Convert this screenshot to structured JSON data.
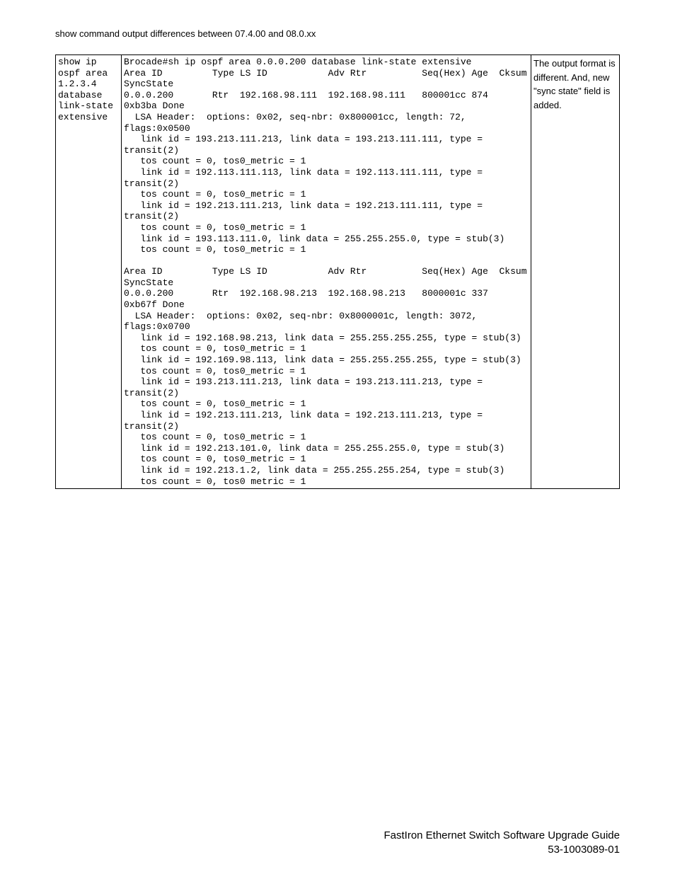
{
  "header": {
    "title": "show command output differences between 07.4.00 and 08.0.xx"
  },
  "table": {
    "command": "show ip ospf area 1.2.3.4 database link-state extensive",
    "output": "Brocade#sh ip ospf area 0.0.0.200 database link-state extensive\nArea ID         Type LS ID           Adv Rtr          Seq(Hex) Age  Cksum  \nSyncState\n0.0.0.200       Rtr  192.168.98.111  192.168.98.111   800001cc 874   \n0xb3ba Done\n  LSA Header:  options: 0x02, seq-nbr: 0x800001cc, length: 72, \nflags:0x0500\n   link id = 193.213.111.213, link data = 193.213.111.111, type = \ntransit(2)\n   tos count = 0, tos0_metric = 1\n   link id = 192.113.111.113, link data = 192.113.111.111, type = \ntransit(2)\n   tos count = 0, tos0_metric = 1\n   link id = 192.213.111.213, link data = 192.213.111.111, type = \ntransit(2)\n   tos count = 0, tos0_metric = 1\n   link id = 193.113.111.0, link data = 255.255.255.0, type = stub(3)\n   tos count = 0, tos0_metric = 1\n\nArea ID         Type LS ID           Adv Rtr          Seq(Hex) Age  Cksum  \nSyncState\n0.0.0.200       Rtr  192.168.98.213  192.168.98.213   8000001c 337   \n0xb67f Done\n  LSA Header:  options: 0x02, seq-nbr: 0x8000001c, length: 3072, \nflags:0x0700\n   link id = 192.168.98.213, link data = 255.255.255.255, type = stub(3)\n   tos count = 0, tos0_metric = 1\n   link id = 192.169.98.113, link data = 255.255.255.255, type = stub(3)\n   tos count = 0, tos0_metric = 1\n   link id = 193.213.111.213, link data = 193.213.111.213, type = \ntransit(2)\n   tos count = 0, tos0_metric = 1\n   link id = 192.213.111.213, link data = 192.213.111.213, type = \ntransit(2)\n   tos count = 0, tos0_metric = 1\n   link id = 192.213.101.0, link data = 255.255.255.0, type = stub(3)\n   tos count = 0, tos0_metric = 1\n   link id = 192.213.1.2, link data = 255.255.255.254, type = stub(3)\n   tos count = 0, tos0 metric = 1",
    "note": "The output format is different. And, new \"sync state\" field is added."
  },
  "footer": {
    "line1": "FastIron Ethernet Switch Software Upgrade Guide",
    "line2": "53-1003089-01"
  }
}
